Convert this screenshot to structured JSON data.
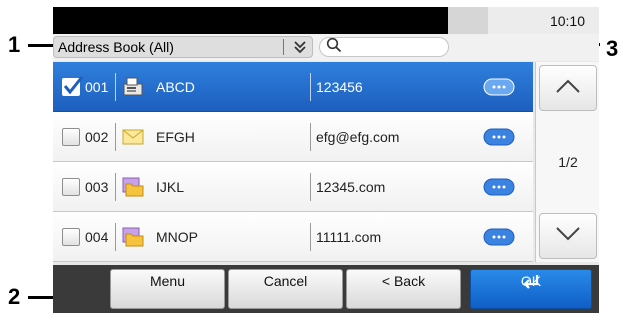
{
  "callouts": {
    "one": "1",
    "two": "2",
    "three": "3"
  },
  "status": {
    "time": "10:10"
  },
  "header": {
    "address_book_label": "Address Book (All)"
  },
  "list": {
    "rows": [
      {
        "number": "001",
        "name": "ABCD",
        "address": "123456",
        "type": "fax-icon",
        "selected": true
      },
      {
        "number": "002",
        "name": "EFGH",
        "address": "efg@efg.com",
        "type": "email-icon",
        "selected": false
      },
      {
        "number": "003",
        "name": "IJKL",
        "address": "12345.com",
        "type": "folder-icon",
        "selected": false
      },
      {
        "number": "004",
        "name": "MNOP",
        "address": "11111.com",
        "type": "folder-icon",
        "selected": false
      }
    ]
  },
  "pager": {
    "page": "1/2"
  },
  "buttons": {
    "menu": "Menu",
    "cancel": "Cancel",
    "back": "< Back",
    "ok": "OK"
  },
  "colors": {
    "accent": "#1d6fd4",
    "bottom_bar": "#3a3a3a"
  }
}
